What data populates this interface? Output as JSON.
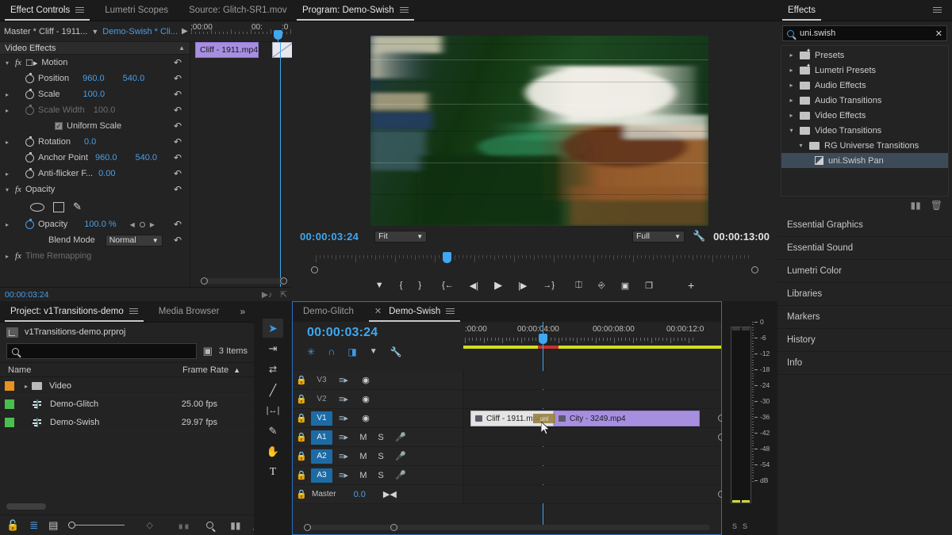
{
  "effect_controls": {
    "tabs": [
      {
        "label": "Effect Controls",
        "active": true,
        "menu": true
      },
      {
        "label": "Lumetri Scopes",
        "active": false
      },
      {
        "label": "Source: Glitch-SR1.mov",
        "active": false
      }
    ],
    "overflow": "»",
    "master_label": "Master * Cliff - 1911...",
    "sequence_label": "Demo-Swish * Cli...",
    "section_video_effects": "Video Effects",
    "groups": [
      {
        "name": "Motion",
        "fx": "fx"
      },
      {
        "name": "Opacity",
        "fx": "fx"
      },
      {
        "name": "Time Remapping",
        "fx": "fx"
      }
    ],
    "params": [
      {
        "label": "Position",
        "v1": "960.0",
        "v2": "540.0"
      },
      {
        "label": "Scale",
        "v1": "100.0",
        "v2": ""
      },
      {
        "label": "Scale Width",
        "v1": "100.0",
        "v2": ""
      },
      {
        "label": "Uniform Scale",
        "v1": "",
        "v2": ""
      },
      {
        "label": "Rotation",
        "v1": "0.0",
        "v2": ""
      },
      {
        "label": "Anchor Point",
        "v1": "960.0",
        "v2": "540.0"
      },
      {
        "label": "Anti-flicker F...",
        "v1": "0.00",
        "v2": ""
      },
      {
        "label": "Opacity",
        "v1": "100.0 %",
        "v2": ""
      },
      {
        "label": "Blend Mode",
        "v1": "Normal",
        "v2": ""
      }
    ],
    "blend_mode_value": "Normal",
    "ruler": {
      "start": ":00:00",
      "mid": "00:",
      "end": ":0"
    },
    "clip_name": "Cliff - 1911.mp4",
    "footer_timecode": "00:00:03:24"
  },
  "program": {
    "tab_label": "Program: Demo-Swish",
    "current_timecode": "00:00:03:24",
    "fit_value": "Fit",
    "quality_value": "Full",
    "duration_timecode": "00:00:13:00",
    "buttons": [
      {
        "name": "add-marker-button",
        "glyph": "▼"
      },
      {
        "name": "mark-in-button",
        "glyph": "{"
      },
      {
        "name": "mark-out-button",
        "glyph": "}"
      },
      {
        "name": "go-to-in-button",
        "glyph": "{←"
      },
      {
        "name": "step-back-button",
        "glyph": "◀|"
      },
      {
        "name": "play-stop-button",
        "glyph": "▶"
      },
      {
        "name": "step-forward-button",
        "glyph": "|▶"
      },
      {
        "name": "go-to-out-button",
        "glyph": "→}"
      },
      {
        "name": "lift-button",
        "glyph": "⊓"
      },
      {
        "name": "extract-button",
        "glyph": "⊔"
      },
      {
        "name": "export-frame-button",
        "glyph": "▣"
      },
      {
        "name": "comparison-view-button",
        "glyph": "❐"
      },
      {
        "name": "button-editor-plus",
        "glyph": "+"
      }
    ]
  },
  "project": {
    "tabs": [
      {
        "label": "Project: v1Transitions-demo",
        "active": true,
        "menu": true
      },
      {
        "label": "Media Browser",
        "active": false
      }
    ],
    "overflow": "»",
    "project_file": "v1Transitions-demo.prproj",
    "search_placeholder": "",
    "item_count": "3 Items",
    "columns": [
      "Name",
      "Frame Rate"
    ],
    "rows": [
      {
        "name": "Video",
        "frame_rate": "",
        "color": "#e8921f",
        "kind": "folder"
      },
      {
        "name": "Demo-Glitch",
        "frame_rate": "25.00 fps",
        "color": "#4bbf4b",
        "kind": "sequence"
      },
      {
        "name": "Demo-Swish",
        "frame_rate": "29.97 fps",
        "color": "#4bbf4b",
        "kind": "sequence"
      }
    ],
    "bottom_buttons": [
      {
        "name": "project-lock-icon",
        "glyph": "🔓"
      },
      {
        "name": "list-view-icon",
        "glyph": "≣"
      },
      {
        "name": "icon-view-icon",
        "glyph": "▣"
      },
      {
        "name": "zoom-slider",
        "glyph": ""
      },
      {
        "name": "sort-icon",
        "glyph": "◇"
      },
      {
        "name": "automate-to-sequence-icon",
        "glyph": "▒"
      },
      {
        "name": "find-icon",
        "glyph": "⚲"
      },
      {
        "name": "new-bin-icon",
        "glyph": "▬"
      },
      {
        "name": "new-item-icon",
        "glyph": "◥"
      },
      {
        "name": "delete-icon",
        "glyph": "🗑"
      }
    ]
  },
  "timeline": {
    "tabs": [
      {
        "label": "Demo-Glitch",
        "active": false
      },
      {
        "label": "Demo-Swish",
        "active": true
      }
    ],
    "playhead_timecode": "00:00:03:24",
    "ruler_labels": [
      ":00:00",
      "00:00:04:00",
      "00:00:08:00",
      "00:00:12:0"
    ],
    "tools": [
      {
        "name": "selection-tool",
        "glyph": "➤",
        "selected": true
      },
      {
        "name": "track-select-forward-tool",
        "glyph": "⇥"
      },
      {
        "name": "ripple-edit-tool",
        "glyph": "⇄"
      },
      {
        "name": "razor-tool",
        "glyph": "╱"
      },
      {
        "name": "slip-tool",
        "glyph": "|↔|"
      },
      {
        "name": "pen-tool",
        "glyph": "✒"
      },
      {
        "name": "hand-tool",
        "glyph": "✋"
      },
      {
        "name": "type-tool",
        "glyph": "T"
      }
    ],
    "header_buttons": [
      {
        "name": "snap-icon",
        "glyph": "✳"
      },
      {
        "name": "linked-selection-icon",
        "glyph": "∩"
      },
      {
        "name": "add-marker-icon",
        "glyph": "◨"
      },
      {
        "name": "marker-icon",
        "glyph": "▼"
      },
      {
        "name": "timeline-settings-icon",
        "glyph": "🔧"
      }
    ],
    "tracks": [
      {
        "id": "V3",
        "type": "video",
        "targeted": false
      },
      {
        "id": "V2",
        "type": "video",
        "targeted": false
      },
      {
        "id": "V1",
        "type": "video",
        "targeted": true
      },
      {
        "id": "A1",
        "type": "audio",
        "targeted": true
      },
      {
        "id": "A2",
        "type": "audio",
        "targeted": true
      },
      {
        "id": "A3",
        "type": "audio",
        "targeted": true
      }
    ],
    "master_label": "Master",
    "master_value": "0.0",
    "clips": [
      {
        "name": "Cliff - 1911.mp4",
        "track": "V1",
        "style": "light"
      },
      {
        "name": "City - 3249.mp4",
        "track": "V1",
        "style": "purple"
      }
    ],
    "drop_hint": "uni",
    "mute_label": "M",
    "solo_label": "S",
    "meter_labels": [
      "0",
      "-6",
      "-12",
      "-18",
      "-24",
      "-30",
      "-36",
      "-42",
      "-48",
      "-54",
      "dB"
    ],
    "meter_speakers": [
      "S",
      "S"
    ]
  },
  "effects_panel": {
    "title": "Effects",
    "search_value": "uni.swish",
    "tree": [
      {
        "label": "Presets",
        "depth": 0,
        "expanded": false,
        "star": true
      },
      {
        "label": "Lumetri Presets",
        "depth": 0,
        "expanded": false,
        "star": true
      },
      {
        "label": "Audio Effects",
        "depth": 0,
        "expanded": false
      },
      {
        "label": "Audio Transitions",
        "depth": 0,
        "expanded": false
      },
      {
        "label": "Video Effects",
        "depth": 0,
        "expanded": false
      },
      {
        "label": "Video Transitions",
        "depth": 0,
        "expanded": true
      },
      {
        "label": "RG Universe Transitions",
        "depth": 1,
        "expanded": true
      },
      {
        "label": "uni.Swish Pan",
        "depth": 2,
        "leaf": true,
        "selected": true
      }
    ],
    "footer_buttons": [
      {
        "name": "new-custom-bin-icon",
        "glyph": "▬"
      },
      {
        "name": "delete-custom-item-icon",
        "glyph": "🗑"
      }
    ],
    "docked_panels": [
      {
        "label": "Essential Graphics"
      },
      {
        "label": "Essential Sound"
      },
      {
        "label": "Lumetri Color"
      },
      {
        "label": "Libraries"
      },
      {
        "label": "Markers"
      },
      {
        "label": "History"
      },
      {
        "label": "Info"
      }
    ]
  },
  "colors": {
    "accent_blue": "#3fa8f0",
    "clip_purple": "#a78fe0",
    "work_bar_yellow": "#d2de22",
    "track_target_blue": "#1d6ba5",
    "selection_row": "#3d4a58"
  }
}
